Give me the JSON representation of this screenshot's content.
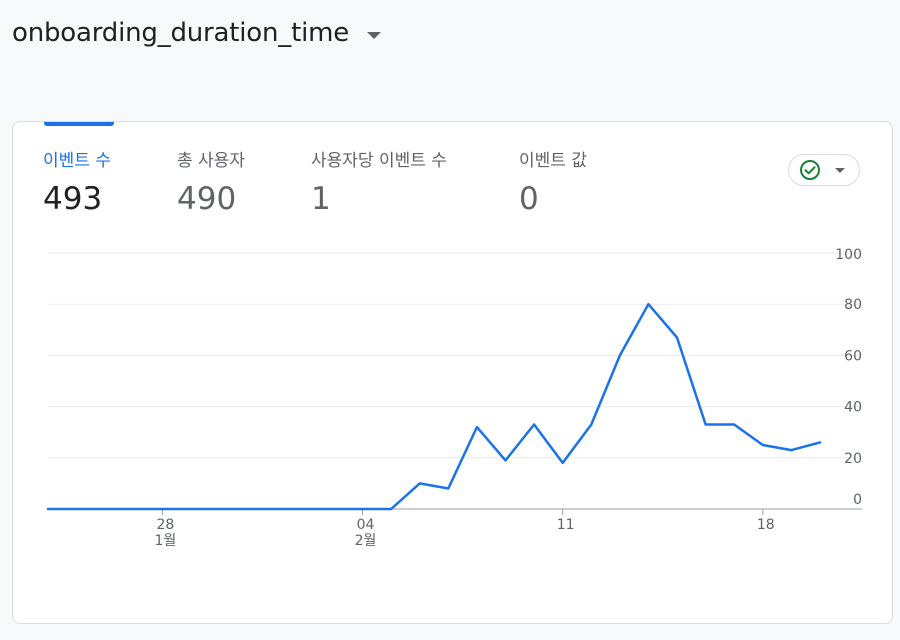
{
  "header": {
    "title": "onboarding_duration_time"
  },
  "metrics": [
    {
      "label": "이벤트 수",
      "value": "493"
    },
    {
      "label": "총 사용자",
      "value": "490"
    },
    {
      "label": "사용자당 이벤트 수",
      "value": "1"
    },
    {
      "label": "이벤트 값",
      "value": "0"
    }
  ],
  "status_chip": {
    "icon": "check-circle-icon",
    "color": "#188038"
  },
  "colors": {
    "accent": "#1a73e8",
    "line": "#1a73e8"
  },
  "chart_data": {
    "type": "line",
    "title": "",
    "xlabel": "",
    "ylabel": "",
    "ylim": [
      0,
      100
    ],
    "yticks": [
      0,
      20,
      40,
      60,
      80,
      100
    ],
    "grid": true,
    "x_ticks": [
      {
        "day": "28",
        "month": "1월",
        "index": 4
      },
      {
        "day": "04",
        "month": "2월",
        "index": 11
      },
      {
        "day": "11",
        "month": "",
        "index": 18
      },
      {
        "day": "18",
        "month": "",
        "index": 25
      }
    ],
    "x": [
      "01-24",
      "01-25",
      "01-26",
      "01-27",
      "01-28",
      "01-29",
      "01-30",
      "01-31",
      "02-01",
      "02-02",
      "02-03",
      "02-04",
      "02-05",
      "02-06",
      "02-07",
      "02-08",
      "02-09",
      "02-10",
      "02-11",
      "02-12",
      "02-13",
      "02-14",
      "02-15",
      "02-16",
      "02-17",
      "02-18",
      "02-19",
      "02-20"
    ],
    "series": [
      {
        "values": [
          0,
          0,
          0,
          0,
          0,
          0,
          0,
          0,
          0,
          0,
          0,
          0,
          0,
          10,
          8,
          32,
          19,
          33,
          18,
          33,
          60,
          80,
          67,
          33,
          33,
          25,
          23,
          26
        ]
      }
    ]
  }
}
